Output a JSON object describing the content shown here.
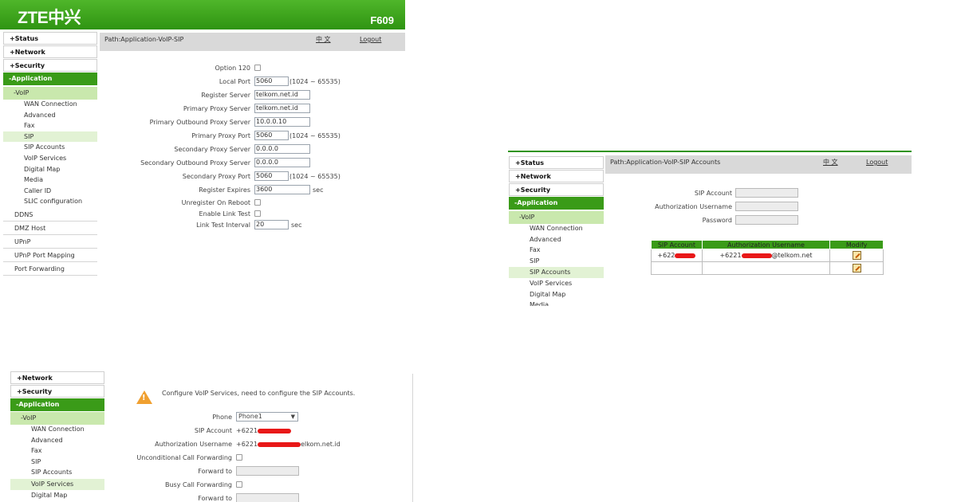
{
  "brand": {
    "logo": "ZTE中兴",
    "model": "F609"
  },
  "panel1": {
    "nav": {
      "status": "+Status",
      "network": "+Network",
      "security": "+Security",
      "application": "-Application",
      "voip": "-VoIP",
      "voip_items": [
        "WAN Connection",
        "Advanced",
        "Fax",
        "SIP",
        "SIP Accounts",
        "VoIP Services",
        "Digital Map",
        "Media",
        "Caller ID",
        "SLIC configuration"
      ],
      "after_items": [
        "DDNS",
        "DMZ Host",
        "UPnP",
        "UPnP Port Mapping",
        "Port Forwarding"
      ]
    },
    "path": "Path:Application-VoIP-SIP",
    "lang": "中 文",
    "logout": "Logout",
    "form": {
      "option120": "Option 120",
      "local_port": "Local Port",
      "local_port_value": "5060",
      "local_port_range": "(1024 ~ 65535)",
      "register_server": "Register Server",
      "register_server_value": "telkom.net.id",
      "primary_proxy_server": "Primary Proxy Server",
      "primary_proxy_server_value": "telkom.net.id",
      "primary_outbound": "Primary Outbound Proxy Server",
      "primary_outbound_value": "10.0.0.10",
      "primary_proxy_port": "Primary Proxy Port",
      "primary_proxy_port_value": "5060",
      "primary_proxy_port_range": "(1024 ~ 65535)",
      "secondary_proxy_server": "Secondary Proxy Server",
      "secondary_proxy_server_value": "0.0.0.0",
      "secondary_outbound": "Secondary Outbound Proxy Server",
      "secondary_outbound_value": "0.0.0.0",
      "secondary_proxy_port": "Secondary Proxy Port",
      "secondary_proxy_port_value": "5060",
      "secondary_proxy_port_range": "(1024 ~ 65535)",
      "register_expires": "Register Expires",
      "register_expires_value": "3600",
      "register_expires_unit": "sec",
      "unregister_on_reboot": "Unregister On Reboot",
      "enable_link_test": "Enable Link Test",
      "link_test_interval": "Link Test Interval",
      "link_test_interval_value": "20",
      "link_test_interval_unit": "sec"
    }
  },
  "panel2": {
    "nav": {
      "status": "+Status",
      "network": "+Network",
      "security": "+Security",
      "application": "-Application",
      "voip": "-VoIP",
      "voip_items": [
        "WAN Connection",
        "Advanced",
        "Fax",
        "SIP",
        "SIP Accounts",
        "VoIP Services",
        "Digital Map",
        "Media"
      ]
    },
    "path": "Path:Application-VoIP-SIP Accounts",
    "lang": "中 文",
    "logout": "Logout",
    "form": {
      "sip_account": "SIP Account",
      "auth_username": "Authorization Username",
      "password": "Password"
    },
    "table": {
      "headers": [
        "SIP Account",
        "Authorization Username",
        "Modify"
      ],
      "rows": [
        {
          "sip": "+622",
          "auth_prefix": "+6221",
          "auth_suffix": "@telkom.net"
        },
        {
          "sip": "",
          "auth_prefix": "",
          "auth_suffix": ""
        }
      ]
    }
  },
  "panel3": {
    "nav": {
      "network": "+Network",
      "security": "+Security",
      "application": "-Application",
      "voip": "-VoIP",
      "voip_items": [
        "WAN Connection",
        "Advanced",
        "Fax",
        "SIP",
        "SIP Accounts",
        "VoIP Services",
        "Digital Map"
      ]
    },
    "warning": "Configure VoIP Services, need to configure the SIP Accounts.",
    "form": {
      "phone": "Phone",
      "phone_value": "Phone1",
      "sip_account": "SIP Account",
      "sip_account_value": "+6221",
      "auth_username": "Authorization Username",
      "auth_username_prefix": "+6221",
      "auth_username_suffix": "elkom.net.id",
      "uncond_forward": "Unconditional Call Forwarding",
      "forward_to": "Forward to",
      "busy_forward": "Busy Call Forwarding",
      "forward_to_2": "Forward to"
    }
  },
  "colors": {
    "brand_green": "#3a9b18",
    "voip_green": "#c9e8ad",
    "path_gray": "#d9d9d9",
    "redaction": "#e81818"
  },
  "icons": [
    "warning-icon",
    "edit-icon",
    "dropdown-arrow-icon"
  ]
}
